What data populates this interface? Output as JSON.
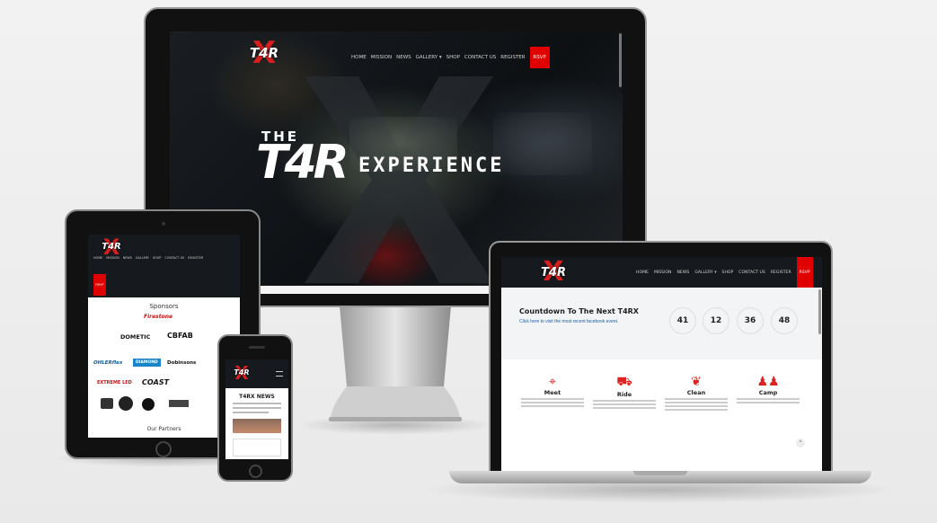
{
  "colors": {
    "accent": "#e00000",
    "nav_dark": "#16191d",
    "page_bg": "#efefef"
  },
  "brand": {
    "logo_text": "T4R"
  },
  "nav": {
    "items": [
      "HOME",
      "MISSION",
      "NEWS",
      "GALLERY",
      "SHOP",
      "CONTACT US",
      "REGISTER"
    ],
    "rsvp": "RSVP",
    "gallery_caret": "▾"
  },
  "desktop": {
    "hero_the": "THE",
    "hero_logo": "T4R",
    "hero_experience": "EXPERIENCE"
  },
  "laptop": {
    "countdown_title": "Countdown To The Next T4RX",
    "countdown_link": "Click here to visit the most recent facebook event.",
    "countdown": [
      "41",
      "12",
      "36",
      "48"
    ],
    "features": [
      {
        "icon": "map-pin-icon",
        "title": "Meet"
      },
      {
        "icon": "car-icon",
        "title": "Ride"
      },
      {
        "icon": "leaf-icon",
        "title": "Clean"
      },
      {
        "icon": "people-icon",
        "title": "Camp"
      }
    ],
    "back_to_top": "^"
  },
  "tablet": {
    "sponsors_title": "Sponsors",
    "sponsors": [
      "Firestone",
      "DOMETIC",
      "CBFAB",
      "OHLERflex",
      "DIAMOND",
      "Dobinsons",
      "EXTREME LED",
      "COAST",
      "",
      "",
      "",
      ""
    ],
    "partners_title": "Our Partners"
  },
  "phone": {
    "news_title": "T4RX NEWS"
  }
}
